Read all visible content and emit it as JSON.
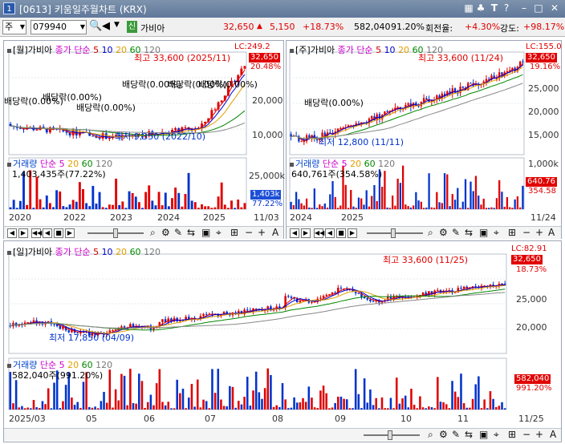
{
  "window": {
    "screen_no": "[0613]",
    "title": "키움일주월차트 (KRX)",
    "number_badge": "1"
  },
  "toolbar": {
    "market": "주",
    "code": "079940",
    "sector_badge": "신",
    "name": "가비아",
    "price": "32,650",
    "change": "5,150",
    "change_pct": "+18.73%",
    "volume": "582,040",
    "volume_pct": "91.20%",
    "turnover_label": "회전율:",
    "turnover": "+4.30%",
    "strength_label": "강도:",
    "strength": "+98.17%",
    "colors": {
      "up": "#e00000",
      "down": "#0033cc"
    }
  },
  "charts": {
    "monthly": {
      "legend": {
        "title": "[월]가비아",
        "ma": "종가 단순",
        "ma_periods": [
          "5",
          "10",
          "20",
          "60",
          "120"
        ]
      },
      "lc": "LC:249.2",
      "high_note": "최고 33,600 (2025/11)",
      "low_note": "최저 9,350 (2022/10)",
      "price_tag": "32,650",
      "pct_tag": "20.48%",
      "y_ticks": [
        "20,000",
        "10,000"
      ],
      "dividends": [
        "배당락(0.00%)",
        "배당락(0.00%)",
        "배당락(0.00%)",
        "배당락(0.00%)",
        "배당락(0.00%)",
        "배당락(0.00%)"
      ],
      "vol_legend": {
        "title": "거래량",
        "ma": "단순 5",
        "ma_periods": [
          "20",
          "60",
          "120"
        ]
      },
      "vol_value": "1,403,435주(77.22%)",
      "vol_ticks": [
        "25,000k"
      ],
      "vol_tag": "1,403k",
      "vol_pct": "77.22%",
      "x_labels": [
        "2020",
        "2022",
        "2023",
        "2024",
        "2025",
        "11/03"
      ]
    },
    "weekly": {
      "legend": {
        "title": "[주]가비아",
        "ma": "종가 단순",
        "ma_periods": [
          "5",
          "10",
          "20",
          "60",
          "120"
        ]
      },
      "lc": "LC:155.0",
      "high_note": "최고 33,600 (11/24)",
      "low_note": "최저 12,800 (11/11)",
      "price_tag": "32,650",
      "pct_tag": "19.16%",
      "y_ticks": [
        "25,000",
        "20,000",
        "15,000"
      ],
      "dividends": [
        "배당락(0.00%)"
      ],
      "vol_legend": {
        "title": "거래량",
        "ma": "단순 5",
        "ma_periods": [
          "20",
          "60",
          "120"
        ]
      },
      "vol_value": "640,761주(354.58%)",
      "vol_ticks": [
        "1,000k"
      ],
      "vol_tag": "640.76",
      "vol_pct": "354.58",
      "x_labels": [
        "2024",
        "2025",
        "11/24"
      ]
    },
    "daily": {
      "legend": {
        "title": "[일]가비아",
        "ma": "종가 단순",
        "ma_periods": [
          "5",
          "10",
          "20",
          "60",
          "120"
        ]
      },
      "lc": "LC:82.91",
      "high_note": "최고 33,600 (11/25)",
      "low_note": "최저 17,850 (04/09)",
      "price_tag": "32,650",
      "pct_tag": "18.73%",
      "y_ticks": [
        "25,000",
        "20,000"
      ],
      "vol_legend": {
        "title": "거래량",
        "ma": "단순 5",
        "ma_periods": [
          "20",
          "60",
          "120"
        ]
      },
      "vol_value": "582,040주(991.20%)",
      "vol_tag": "582,040",
      "vol_pct": "991.20%",
      "x_labels": [
        "2025/03",
        "05",
        "06",
        "07",
        "08",
        "09",
        "10",
        "11",
        "11/25"
      ]
    }
  },
  "controls": {
    "zoom_plus": "+",
    "zoom_minus": "−",
    "auto": "A"
  }
}
